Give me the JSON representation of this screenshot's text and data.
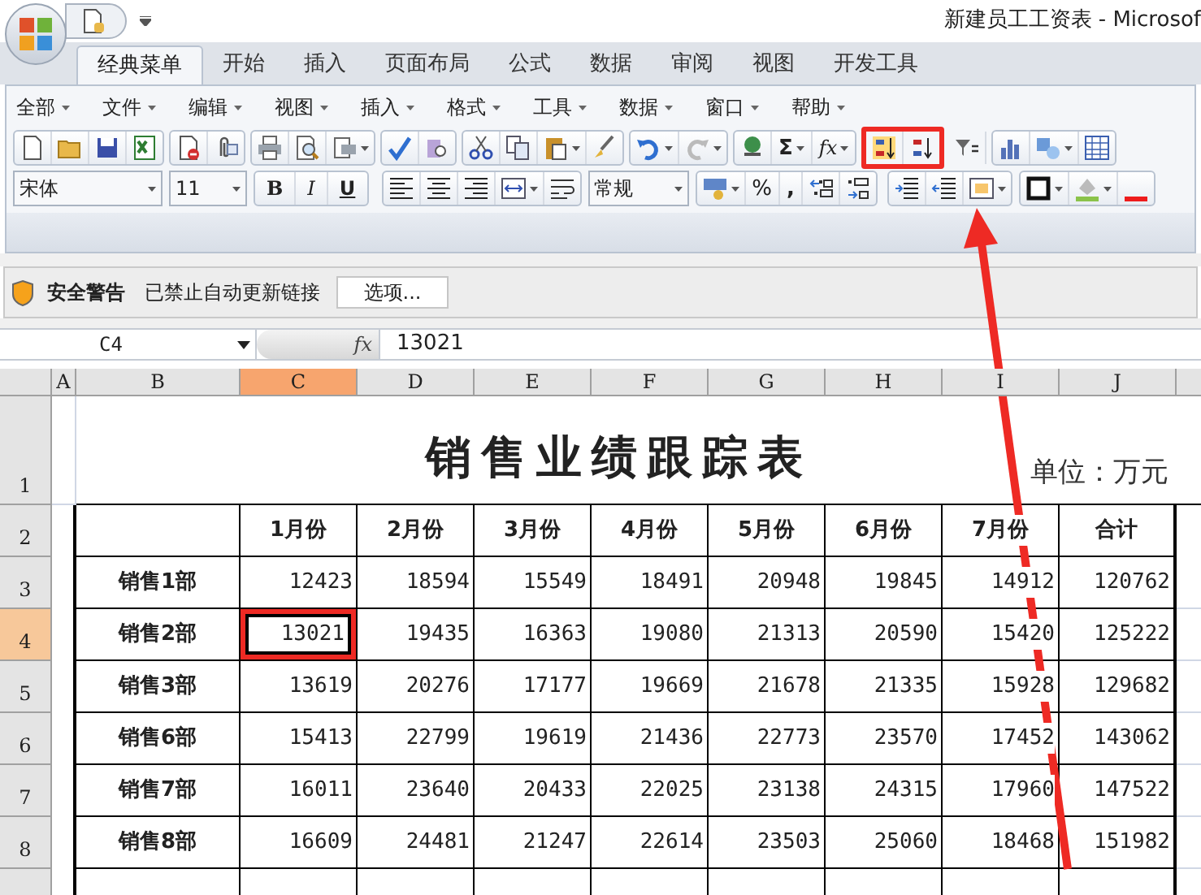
{
  "window": {
    "title": "新建员工工资表 - Microsof"
  },
  "tabs": [
    {
      "label": "经典菜单",
      "selected": true
    },
    {
      "label": "开始",
      "selected": false
    },
    {
      "label": "插入",
      "selected": false
    },
    {
      "label": "页面布局",
      "selected": false
    },
    {
      "label": "公式",
      "selected": false
    },
    {
      "label": "数据",
      "selected": false
    },
    {
      "label": "审阅",
      "selected": false
    },
    {
      "label": "视图",
      "selected": false
    },
    {
      "label": "开发工具",
      "selected": false
    }
  ],
  "menus": [
    "全部",
    "文件",
    "编辑",
    "视图",
    "插入",
    "格式",
    "工具",
    "数据",
    "窗口",
    "帮助"
  ],
  "toolbar": {
    "sum": "Σ",
    "function": "fx",
    "sort_highlighted": true
  },
  "format_bar": {
    "font": "宋体",
    "size": "11",
    "bold": "B",
    "italic": "I",
    "underline": "U",
    "number_format": "常规",
    "percent": "%",
    "comma": ","
  },
  "security_bar": {
    "title": "安全警告",
    "message": "已禁止自动更新链接",
    "button": "选项..."
  },
  "formula_bar": {
    "name_box": "C4",
    "fx": "fx",
    "value": "13021"
  },
  "column_headers": [
    {
      "label": "A",
      "selected": false
    },
    {
      "label": "B",
      "selected": false
    },
    {
      "label": "C",
      "selected": true
    },
    {
      "label": "D",
      "selected": false
    },
    {
      "label": "E",
      "selected": false
    },
    {
      "label": "F",
      "selected": false
    },
    {
      "label": "G",
      "selected": false
    },
    {
      "label": "H",
      "selected": false
    },
    {
      "label": "I",
      "selected": false
    },
    {
      "label": "J",
      "selected": false
    }
  ],
  "row_headers": [
    {
      "label": "1",
      "selected": false
    },
    {
      "label": "2",
      "selected": false
    },
    {
      "label": "3",
      "selected": false
    },
    {
      "label": "4",
      "selected": true
    },
    {
      "label": "5",
      "selected": false
    },
    {
      "label": "6",
      "selected": false
    },
    {
      "label": "7",
      "selected": false
    },
    {
      "label": "8",
      "selected": false
    }
  ],
  "sheet": {
    "title": "销售业绩跟踪表",
    "unit": "单位：万元",
    "columns": [
      "1月份",
      "2月份",
      "3月份",
      "4月份",
      "5月份",
      "6月份",
      "7月份",
      "合计"
    ],
    "rows": [
      {
        "label": "销售1部",
        "cells": [
          {
            "value": "12423",
            "selected": false,
            "highlighted": false
          },
          {
            "value": "18594",
            "selected": false,
            "highlighted": false
          },
          {
            "value": "15549",
            "selected": false,
            "highlighted": false
          },
          {
            "value": "18491",
            "selected": false,
            "highlighted": false
          },
          {
            "value": "20948",
            "selected": false,
            "highlighted": false
          },
          {
            "value": "19845",
            "selected": false,
            "highlighted": false
          },
          {
            "value": "14912",
            "selected": false,
            "highlighted": false
          },
          {
            "value": "120762",
            "selected": false,
            "highlighted": false
          }
        ]
      },
      {
        "label": "销售2部",
        "cells": [
          {
            "value": "13021",
            "selected": true,
            "highlighted": true
          },
          {
            "value": "19435",
            "selected": false,
            "highlighted": false
          },
          {
            "value": "16363",
            "selected": false,
            "highlighted": false
          },
          {
            "value": "19080",
            "selected": false,
            "highlighted": false
          },
          {
            "value": "21313",
            "selected": false,
            "highlighted": false
          },
          {
            "value": "20590",
            "selected": false,
            "highlighted": false
          },
          {
            "value": "15420",
            "selected": false,
            "highlighted": false
          },
          {
            "value": "125222",
            "selected": false,
            "highlighted": false
          }
        ]
      },
      {
        "label": "销售3部",
        "cells": [
          {
            "value": "13619",
            "selected": false,
            "highlighted": false
          },
          {
            "value": "20276",
            "selected": false,
            "highlighted": false
          },
          {
            "value": "17177",
            "selected": false,
            "highlighted": false
          },
          {
            "value": "19669",
            "selected": false,
            "highlighted": false
          },
          {
            "value": "21678",
            "selected": false,
            "highlighted": false
          },
          {
            "value": "21335",
            "selected": false,
            "highlighted": false
          },
          {
            "value": "15928",
            "selected": false,
            "highlighted": false
          },
          {
            "value": "129682",
            "selected": false,
            "highlighted": false
          }
        ]
      },
      {
        "label": "销售6部",
        "cells": [
          {
            "value": "15413",
            "selected": false,
            "highlighted": false
          },
          {
            "value": "22799",
            "selected": false,
            "highlighted": false
          },
          {
            "value": "19619",
            "selected": false,
            "highlighted": false
          },
          {
            "value": "21436",
            "selected": false,
            "highlighted": false
          },
          {
            "value": "22773",
            "selected": false,
            "highlighted": false
          },
          {
            "value": "23570",
            "selected": false,
            "highlighted": false
          },
          {
            "value": "17452",
            "selected": false,
            "highlighted": false
          },
          {
            "value": "143062",
            "selected": false,
            "highlighted": false
          }
        ]
      },
      {
        "label": "销售7部",
        "cells": [
          {
            "value": "16011",
            "selected": false,
            "highlighted": false
          },
          {
            "value": "23640",
            "selected": false,
            "highlighted": false
          },
          {
            "value": "20433",
            "selected": false,
            "highlighted": false
          },
          {
            "value": "22025",
            "selected": false,
            "highlighted": false
          },
          {
            "value": "23138",
            "selected": false,
            "highlighted": false
          },
          {
            "value": "24315",
            "selected": false,
            "highlighted": false
          },
          {
            "value": "17960",
            "selected": false,
            "highlighted": false
          },
          {
            "value": "147522",
            "selected": false,
            "highlighted": false
          }
        ]
      },
      {
        "label": "销售8部",
        "cells": [
          {
            "value": "16609",
            "selected": false,
            "highlighted": false
          },
          {
            "value": "24481",
            "selected": false,
            "highlighted": false
          },
          {
            "value": "21247",
            "selected": false,
            "highlighted": false
          },
          {
            "value": "22614",
            "selected": false,
            "highlighted": false
          },
          {
            "value": "23503",
            "selected": false,
            "highlighted": false
          },
          {
            "value": "25060",
            "selected": false,
            "highlighted": false
          },
          {
            "value": "18468",
            "selected": false,
            "highlighted": false
          },
          {
            "value": "151982",
            "selected": false,
            "highlighted": false
          }
        ]
      }
    ]
  }
}
